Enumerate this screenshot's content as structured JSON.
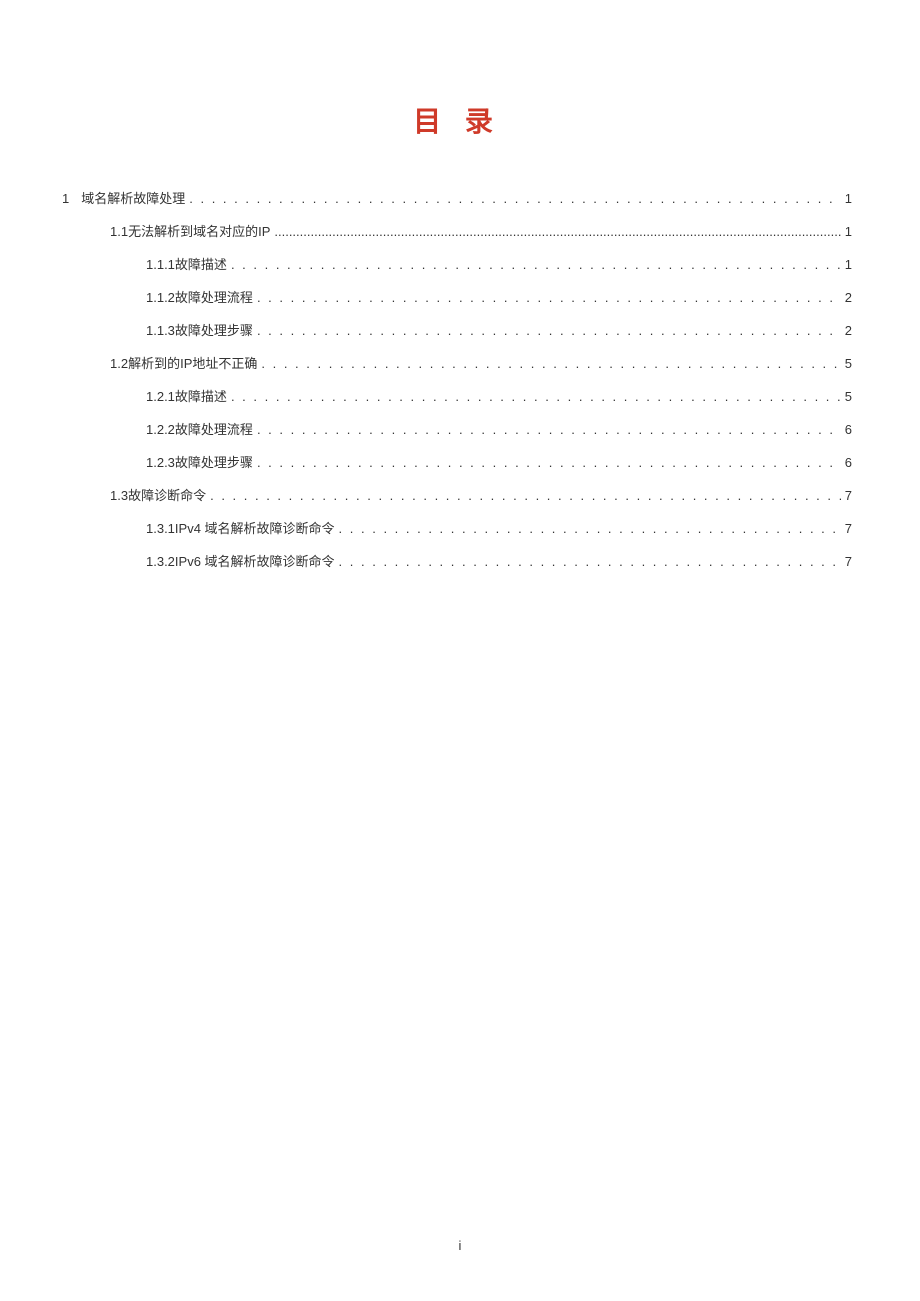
{
  "title": "目 录",
  "pageNumber": "i",
  "entries": [
    {
      "level": 1,
      "number": "1",
      "text": "域名解析故障处理",
      "page": "1",
      "leader": "dot"
    },
    {
      "level": 2,
      "number": "1.1",
      "text": "无法解析到域名对应的IP",
      "page": "1",
      "leader": "solid"
    },
    {
      "level": 3,
      "number": "1.1.1",
      "text": "故障描述",
      "page": "1",
      "leader": "dot"
    },
    {
      "level": 3,
      "number": "1.1.2",
      "text": "故障处理流程",
      "page": "2",
      "leader": "dot"
    },
    {
      "level": 3,
      "number": "1.1.3",
      "text": "故障处理步骤",
      "page": "2",
      "leader": "dot"
    },
    {
      "level": 2,
      "number": "1.2",
      "text": "解析到的IP地址不正确",
      "page": "5",
      "leader": "dot"
    },
    {
      "level": 3,
      "number": "1.2.1",
      "text": "故障描述",
      "page": "5",
      "leader": "dot"
    },
    {
      "level": 3,
      "number": "1.2.2",
      "text": "故障处理流程",
      "page": "6",
      "leader": "dot"
    },
    {
      "level": 3,
      "number": "1.2.3",
      "text": "故障处理步骤",
      "page": "6",
      "leader": "dot"
    },
    {
      "level": 2,
      "number": "1.3",
      "text": "故障诊断命令",
      "page": "7",
      "leader": "dot"
    },
    {
      "level": 3,
      "number": "1.3.1",
      "text": "IPv4 域名解析故障诊断命令",
      "page": "7",
      "leader": "dot"
    },
    {
      "level": 3,
      "number": "1.3.2",
      "text": "IPv6 域名解析故障诊断命令",
      "page": "7",
      "leader": "dot"
    }
  ]
}
